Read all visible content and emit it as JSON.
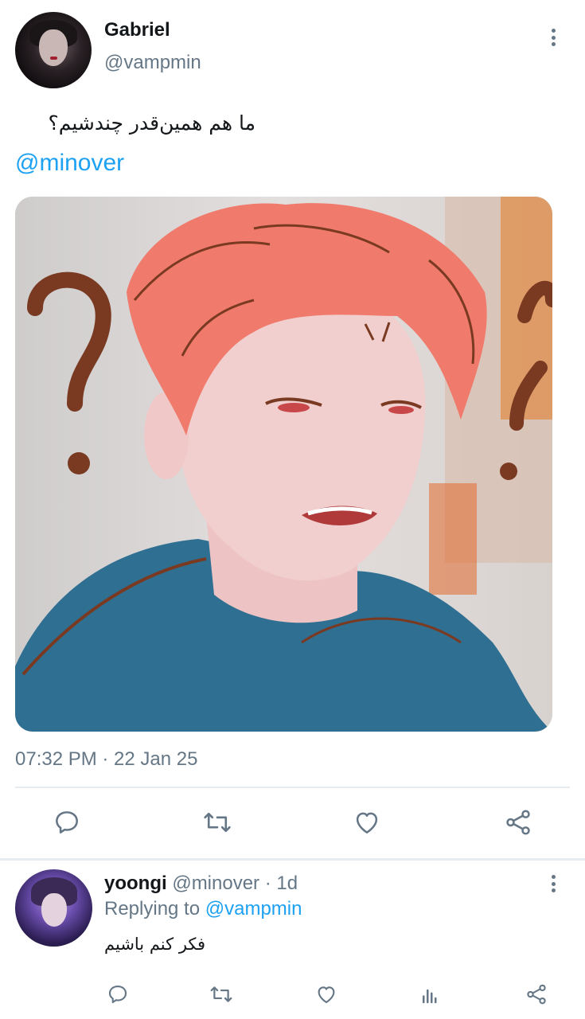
{
  "tweet": {
    "author_name": "Gabriel",
    "author_handle": "@vampmin",
    "text": "ما هم همین‌قدر چندشیم؟",
    "mention": "@minover",
    "timestamp": "07:32 PM · 22 Jan 25",
    "icons": {
      "more": "more-vertical-icon",
      "reply": "comment-icon",
      "retweet": "retweet-icon",
      "like": "heart-icon",
      "share": "share-icon"
    }
  },
  "reply": {
    "author_name": "yoongi",
    "author_handle": "@minover",
    "age": "· 1d",
    "replying_prefix": "Replying to",
    "replying_to": "@vampmin",
    "text": "فکر کنم باشیم",
    "icons": {
      "more": "more-vertical-icon",
      "reply": "comment-icon",
      "retweet": "retweet-icon",
      "like": "heart-icon",
      "analytics": "analytics-icon",
      "share": "share-icon"
    }
  },
  "colors": {
    "link": "#1da1f2",
    "secondary_text": "#657786",
    "primary_text": "#14171a",
    "divider": "#e6ecf0"
  }
}
